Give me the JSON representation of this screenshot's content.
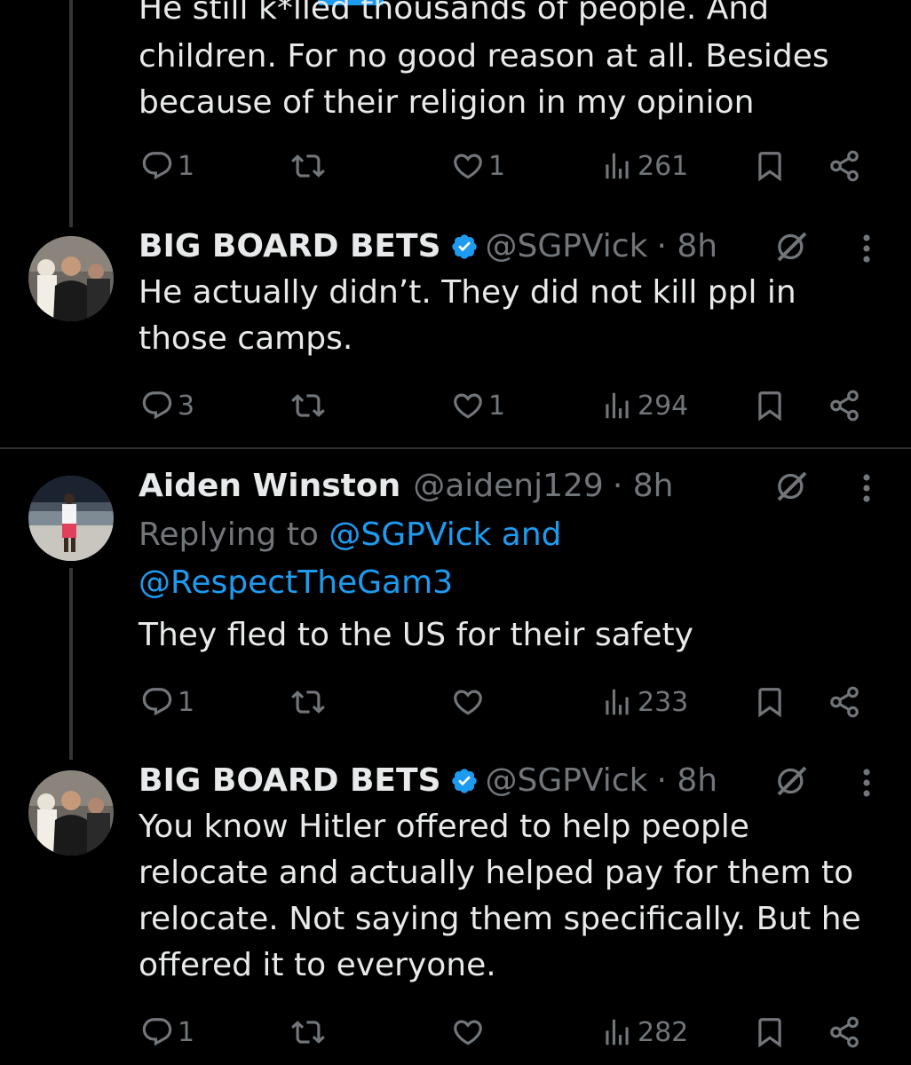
{
  "thread_top": {
    "lines": [
      "He still k*lled thousands of people. And",
      "children. For no good reason at all. Besides",
      "because of their religion in my opinion"
    ],
    "actions": {
      "replies": "1",
      "reposts": "",
      "likes": "1",
      "views": "261"
    }
  },
  "posts": [
    {
      "name": "BIG BOARD BETS",
      "handle": "@SGPVick",
      "time": "· 8h",
      "verified": true,
      "lines": [
        "He actually didn’t. They did not kill ppl in",
        "those camps."
      ],
      "actions": {
        "replies": "3",
        "reposts": "",
        "likes": "1",
        "views": "294"
      }
    },
    {
      "name": "Aiden Winston",
      "handle": "@aidenj129",
      "time": "· 8h",
      "verified": false,
      "replying_prefix": "Replying to",
      "replying_users": "@SGPVick and",
      "replying_users_2": "@RespectTheGam3",
      "lines": [
        "They fled to the US for their safety"
      ],
      "actions": {
        "replies": "1",
        "reposts": "",
        "likes": "",
        "views": "233"
      }
    },
    {
      "name": "BIG BOARD BETS",
      "handle": "@SGPVick",
      "time": "· 8h",
      "verified": true,
      "lines": [
        "You know Hitler offered to help people",
        "relocate and actually helped pay for them to",
        "relocate. Not saying them specifically. But he",
        "offered it to everyone."
      ],
      "actions": {
        "replies": "1",
        "reposts": "",
        "likes": "",
        "views": "282"
      }
    }
  ],
  "icons": {
    "reply": "reply-icon",
    "repost": "repost-icon",
    "like": "heart-icon",
    "views": "views-icon",
    "bookmark": "bookmark-icon",
    "share": "share-icon",
    "verified": "verified-badge-icon",
    "grok": "grok-icon",
    "more": "more-icon"
  },
  "colors": {
    "background": "#000000",
    "text": "#e7e9ea",
    "muted": "#71767b",
    "accent": "#1d9bf0"
  }
}
